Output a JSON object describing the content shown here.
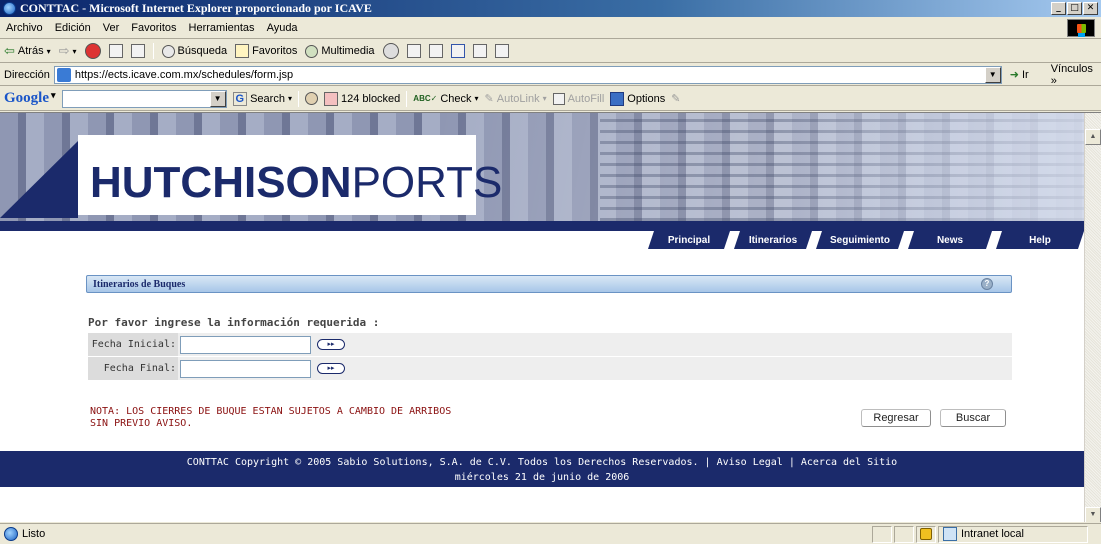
{
  "window": {
    "title": "CONTTAC - Microsoft Internet Explorer proporcionado por ICAVE"
  },
  "menu": [
    "Archivo",
    "Edición",
    "Ver",
    "Favoritos",
    "Herramientas",
    "Ayuda"
  ],
  "toolbar": {
    "back": "Atrás",
    "search": "Búsqueda",
    "favorites": "Favoritos",
    "multimedia": "Multimedia"
  },
  "address": {
    "label": "Dirección",
    "url": "https://ects.icave.com.mx/schedules/form.jsp",
    "go": "Ir",
    "links": "Vínculos"
  },
  "google": {
    "logo": "Google",
    "search": "Search",
    "blocked": "124 blocked",
    "check": "Check",
    "autolink": "AutoLink",
    "autofill": "AutoFill",
    "options": "Options"
  },
  "page": {
    "logo_bold": "HUTCHISON",
    "logo_light": "PORTS",
    "nav": [
      "Principal",
      "Itinerarios",
      "Seguimiento",
      "News",
      "Help"
    ],
    "section_title": "Itinerarios de Buques",
    "prompt": "Por favor ingrese la información requerida :",
    "fecha_inicial_label": "Fecha Inicial:",
    "fecha_final_label": "Fecha Final:",
    "fecha_inicial_value": "",
    "fecha_final_value": "",
    "note_line1": "NOTA: LOS CIERRES DE BUQUE ESTAN SUJETOS A CAMBIO DE ARRIBOS",
    "note_line2": "SIN PREVIO AVISO.",
    "regresar": "Regresar",
    "buscar": "Buscar",
    "footer_line1": "CONTTAC Copyright © 2005 Sabio Solutions, S.A. de C.V. Todos los Derechos Reservados. | Aviso Legal | Acerca del Sitio",
    "footer_line2": "miércoles 21 de junio de 2006"
  },
  "status": {
    "text": "Listo",
    "zone": "Intranet local"
  },
  "colors": {
    "navy": "#1b2a6b",
    "note_red": "#8a1010",
    "section_blue": "#a7c6e8"
  }
}
